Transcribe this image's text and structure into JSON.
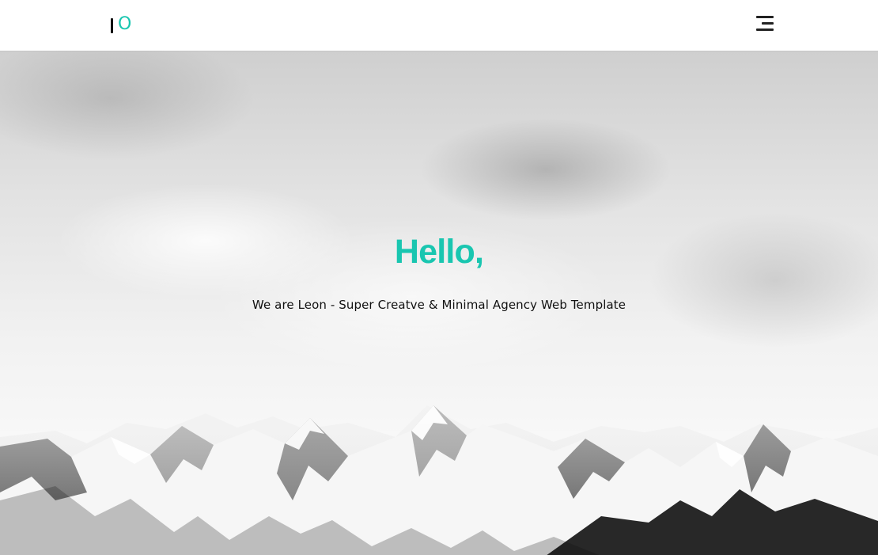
{
  "colors": {
    "accent": "#19c6b0",
    "text": "#111111",
    "background": "#ffffff"
  },
  "header": {
    "logo": {
      "bar_glyph": "I",
      "o_glyph": "O"
    },
    "menu": {
      "icon": "menu-icon"
    }
  },
  "hero": {
    "title": "Hello,",
    "subtitle": "We are Leon - Super Creatve & Minimal Agency Web Template",
    "background_image": "mountains-icon"
  }
}
